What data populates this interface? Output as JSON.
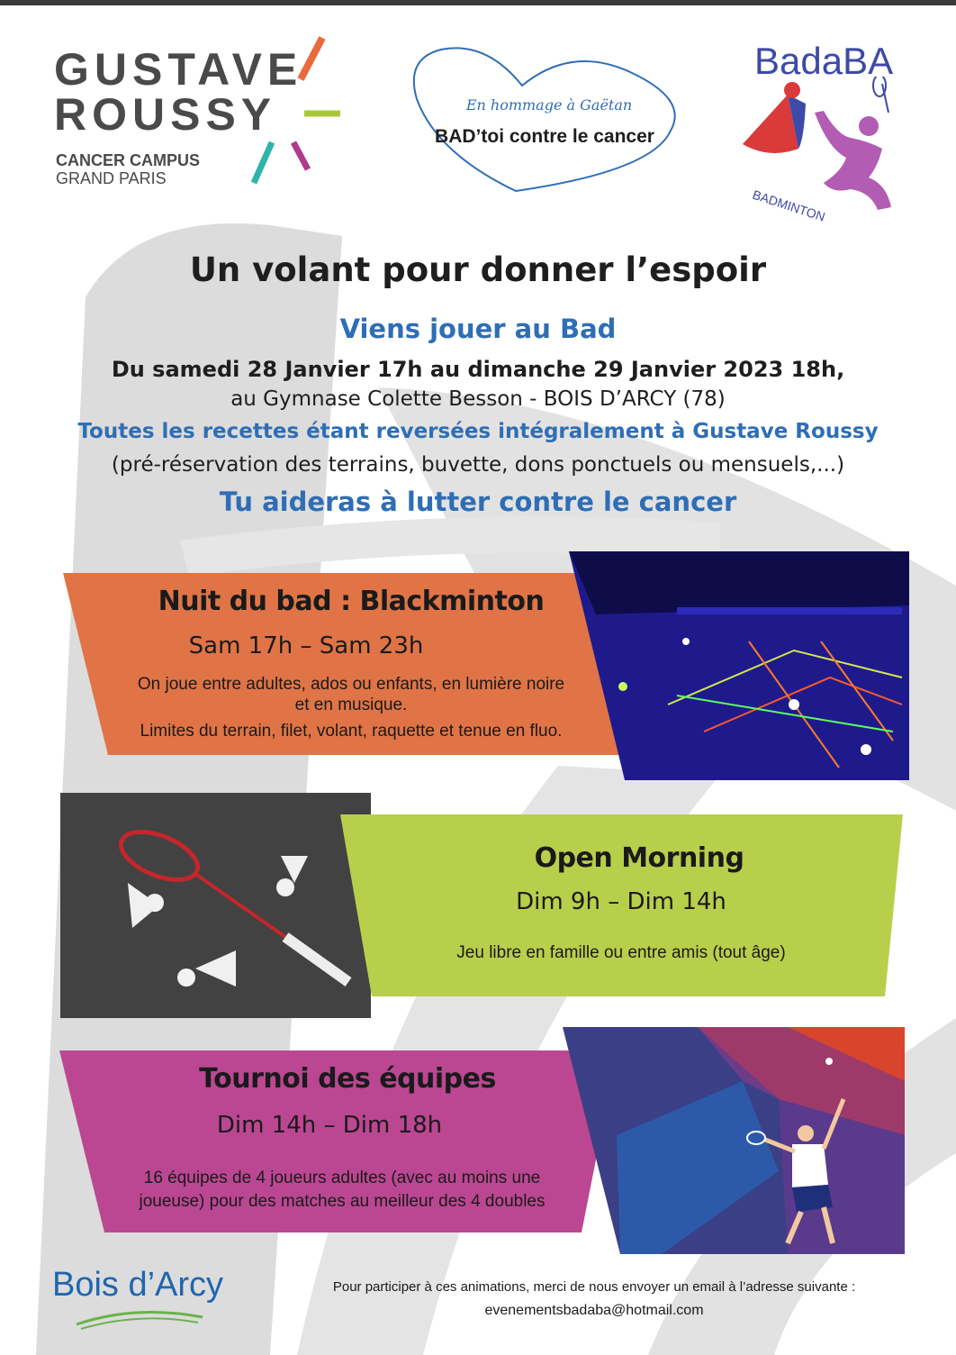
{
  "logos": {
    "gustave_roussy": {
      "line1": "GUSTAVE",
      "line2": "ROUSSY",
      "sub1": "CANCER CAMPUS",
      "sub2": "GRAND PARIS"
    },
    "hommage": {
      "line1": "En hommage à Gaëtan",
      "line2": "BAD’toi contre le cancer",
      "shape": "heart-outline",
      "color": "#2f6eb5"
    },
    "badaba": {
      "title": "BadaBA",
      "curve_text": "BADMINTON"
    },
    "bois_darcy": {
      "name": "Bois d’Arcy"
    }
  },
  "header": {
    "title": "Un volant pour donner l’espoir",
    "subtitle": "Viens jouer au Bad",
    "dates": "Du samedi 28 Janvier 17h au dimanche 29 Janvier 2023 18h,",
    "venue": "au Gymnase Colette Besson - BOIS D’ARCY (78)",
    "recettes": "Toutes les recettes étant reversées intégralement à Gustave Roussy",
    "details": "(pré-réservation des terrains, buvette, dons ponctuels ou mensuels,...)",
    "callout": "Tu aideras à lutter contre le cancer"
  },
  "events": [
    {
      "title": "Nuit du bad : Blackminton",
      "time": "Sam 17h – Sam 23h",
      "desc_lines": [
        "On joue entre adultes, ados ou enfants, en lumière noire",
        "et en musique.",
        "Limites du terrain, filet, volant, raquette et tenue en fluo."
      ],
      "color": "#e07446",
      "photo": "blackminton-gym-photo"
    },
    {
      "title": "Open Morning",
      "time": "Dim 9h – Dim 14h",
      "desc_lines": [
        "Jeu libre en famille ou entre amis (tout âge)"
      ],
      "color": "#b8cf4b",
      "photo": "racket-shuttlecocks-photo"
    },
    {
      "title": "Tournoi des équipes",
      "time": "Dim 14h – Dim 18h",
      "desc_lines": [
        "16 équipes de 4 joueurs adultes (avec au moins une",
        "joueuse) pour des matches au meilleur des 4 doubles"
      ],
      "color": "#bb4792",
      "photo": "player-polygon-illustration"
    }
  ],
  "footer": {
    "line1": "Pour participer à ces animations, merci de nous envoyer un email à l’adresse suivante :",
    "email": "evenementsbadaba@hotmail.com"
  }
}
